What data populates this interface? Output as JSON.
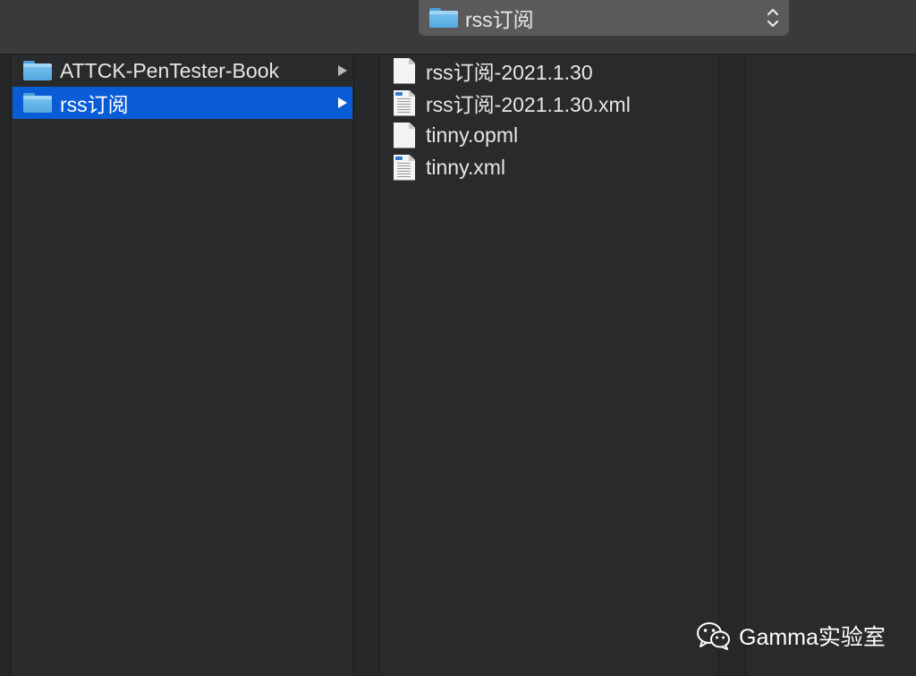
{
  "path_popup": {
    "label": "rss订阅",
    "icon": "folder-icon",
    "control_icon": "up-down-chevron-icon"
  },
  "column1": {
    "items": [
      {
        "label": "ATTCK-PenTester-Book",
        "icon": "folder-icon",
        "selected": false
      },
      {
        "label": "rss订阅",
        "icon": "folder-icon",
        "selected": true
      }
    ]
  },
  "column2": {
    "items": [
      {
        "label": "rss订阅-2021.1.30",
        "icon": "blank-document-icon"
      },
      {
        "label": "rss订阅-2021.1.30.xml",
        "icon": "xml-document-icon"
      },
      {
        "label": "tinny.opml",
        "icon": "blank-document-icon"
      },
      {
        "label": "tinny.xml",
        "icon": "xml-document-icon"
      }
    ]
  },
  "watermark": {
    "text": "Gamma实验室",
    "icon": "wechat-icon"
  },
  "colors": {
    "selection": "#0a5cd6",
    "background": "#282a2c",
    "folder": "#5aaee3"
  }
}
